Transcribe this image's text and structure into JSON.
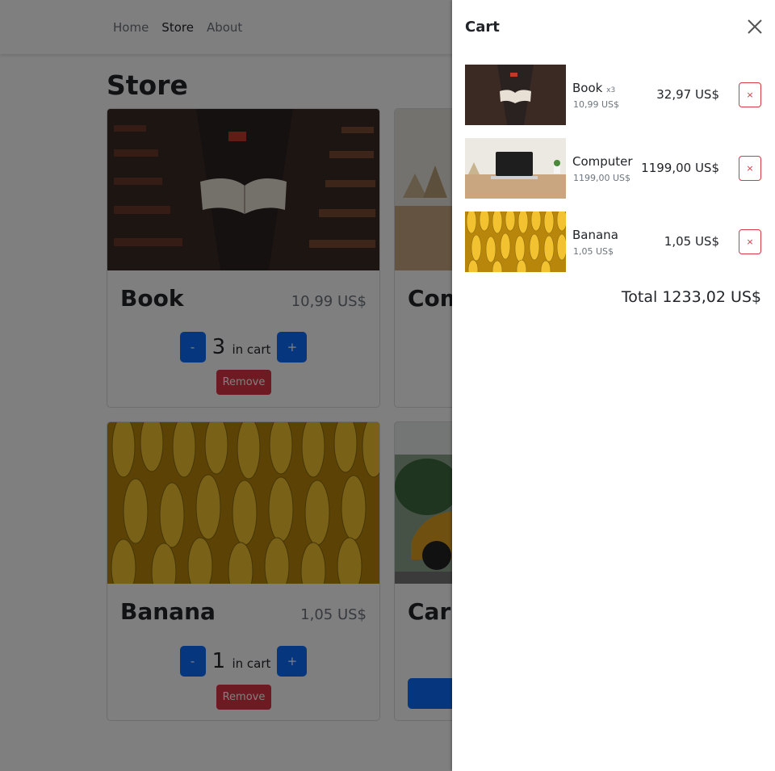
{
  "navbar": {
    "items": [
      "Home",
      "Store",
      "About"
    ],
    "active": "Store"
  },
  "store": {
    "title": "Store",
    "cards": [
      {
        "name": "Book",
        "price": "10,99 US$",
        "qty": "3",
        "in_cart": "in cart",
        "remove": "Remove",
        "minus": "-",
        "plus": "+"
      },
      {
        "name": "Computer",
        "name_visible": "Com"
      },
      {
        "name": "Banana",
        "price": "1,05 US$",
        "qty": "1",
        "in_cart": "in cart",
        "remove": "Remove",
        "minus": "-",
        "plus": "+"
      },
      {
        "name": "Car"
      }
    ]
  },
  "cart": {
    "title": "Cart",
    "items": [
      {
        "name": "Book",
        "qty_badge": "x3",
        "unit_price": "10,99 US$",
        "subtotal": "32,97 US$",
        "remove": "×"
      },
      {
        "name": "Computer",
        "qty_badge": "",
        "unit_price": "1199,00 US$",
        "subtotal": "1199,00 US$",
        "remove": "×"
      },
      {
        "name": "Banana",
        "qty_badge": "",
        "unit_price": "1,05 US$",
        "subtotal": "1,05 US$",
        "remove": "×"
      }
    ],
    "total": "Total 1233,02 US$"
  },
  "colors": {
    "primary": "#0d6efd",
    "danger": "#dc3545",
    "muted": "#6c757d"
  }
}
